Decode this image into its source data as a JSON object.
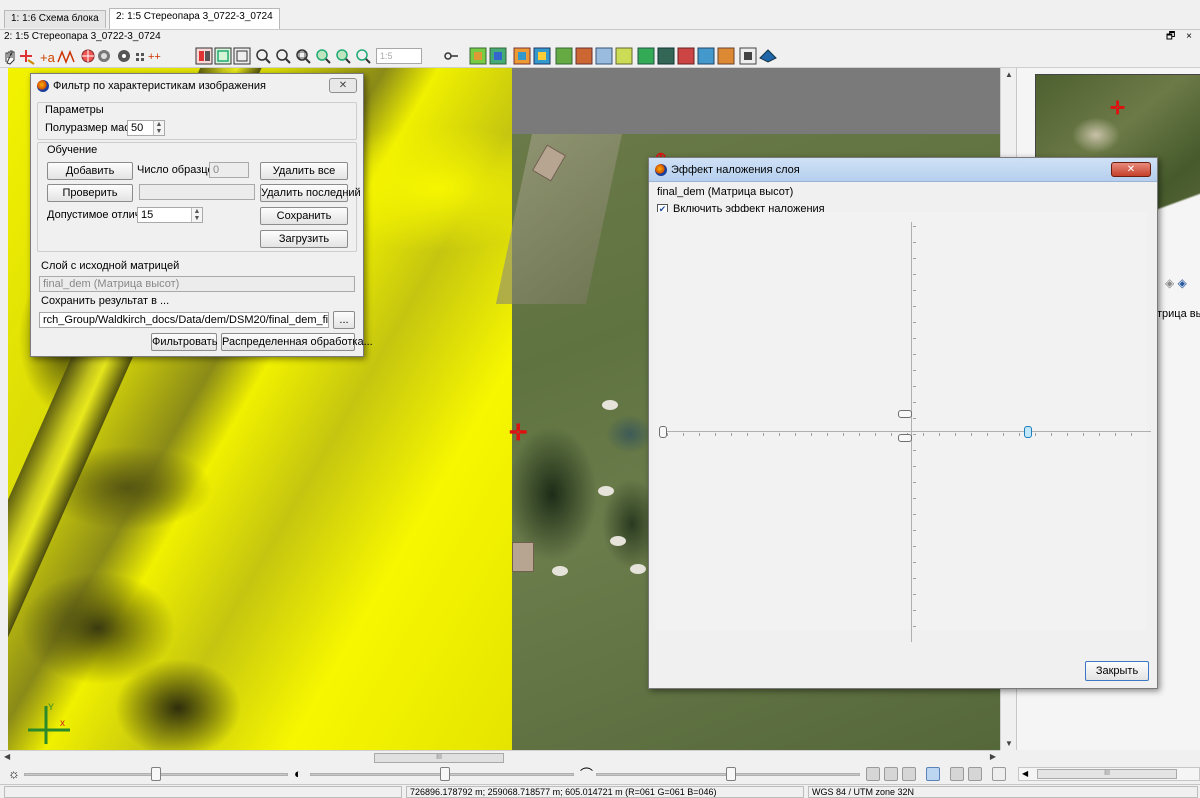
{
  "doc_tabs": [
    {
      "label": "1: 1:6 Схема блока",
      "active": false
    },
    {
      "label": "2: 1:5 Стереопара 3_0722-3_0724",
      "active": true
    }
  ],
  "window_title": "2: 1:5 Стереопара 3_0722-3_0724",
  "window_buttons": "🗗 ×",
  "toolbar": {
    "zoom_value": "1:5",
    "icons": [
      "hand-icon",
      "add-point-icon",
      "add-label-icon",
      "measure-icon",
      "grid-icon",
      "layers-icon",
      "settings-icon",
      "markers-icon",
      "arrows-icon",
      "stereo-split-icon",
      "stereo-anaglyph-icon",
      "stereo-single-icon",
      "zoom-in-icon",
      "zoom-out-icon",
      "zoom-fit-icon",
      "zoom-green-icon",
      "zoom-plus-icon",
      "zoom-select-icon",
      "key-icon",
      "dem-build-icon",
      "dem-color-icon",
      "ortho-icon",
      "mosaic-icon",
      "dem-icon",
      "dtm-icon",
      "filter-icon",
      "contour-icon",
      "diff-icon",
      "tile-icon",
      "grid-dem-icon",
      "table-icon",
      "raster-icon",
      "3d-icon",
      "fly-icon"
    ]
  },
  "filter_dialog": {
    "title": "Фильтр по характеристикам изображения",
    "params_group": "Параметры",
    "mask_label": "Полуразмер маски",
    "mask_value": "50",
    "training_group": "Обучение",
    "add_button": "Добавить",
    "samples_label": "Число образцов",
    "samples_value": "0",
    "delete_all_button": "Удалить все",
    "check_button": "Проверить",
    "check_value": "",
    "delete_last_button": "Удалить последний",
    "tolerance_label": "Допустимое отличие",
    "tolerance_value": "15",
    "save_button": "Сохранить",
    "load_button": "Загрузить",
    "source_layer_label": "Слой с исходной матрицей",
    "source_layer_value": "final_dem (Матрица высот)",
    "save_result_label": "Сохранить результат в ...",
    "save_path": "rch_Group/Waldkirch_docs/Data/dem/DSM20/final_dem_filtered.x-dem",
    "browse_button": "...",
    "filter_button": "Фильтровать",
    "distributed_button": "Распределенная обработка..."
  },
  "overlay_dialog": {
    "title": "Эффект наложения слоя",
    "layer_name": "final_dem (Матрица высот)",
    "enable_checkbox_label": "Включить эффект наложения",
    "enable_checked": true,
    "close_button": "Закрыть",
    "horizontal_slider_fraction": 0.76,
    "upper_vertical_slider_fraction": 0.48,
    "lower_vertical_slider_fraction": 0.52
  },
  "right_pane": {
    "layer_text": "трица выс",
    "icons": [
      "layers-gray-icon",
      "layers-blue-icon"
    ]
  },
  "hscroll_label": "III",
  "right_hscroll_label": "III",
  "sliders": [
    {
      "name": "brightness",
      "icon": "☼",
      "fraction": 0.5
    },
    {
      "name": "contrast",
      "icon": "◐",
      "fraction": 0.51
    },
    {
      "name": "gamma",
      "icon": "⌒",
      "fraction": 0.51
    }
  ],
  "status": {
    "cell1": "",
    "coordinates": "726896.178792 m; 259068.718577 m; 605.014721 m   (R=061 G=061 B=046)",
    "crs": "WGS 84 / UTM zone 32N"
  },
  "colors": {
    "dem_yellow": "#f2f200",
    "accent_blue": "#3b77c5",
    "cross_red": "#e01010"
  }
}
